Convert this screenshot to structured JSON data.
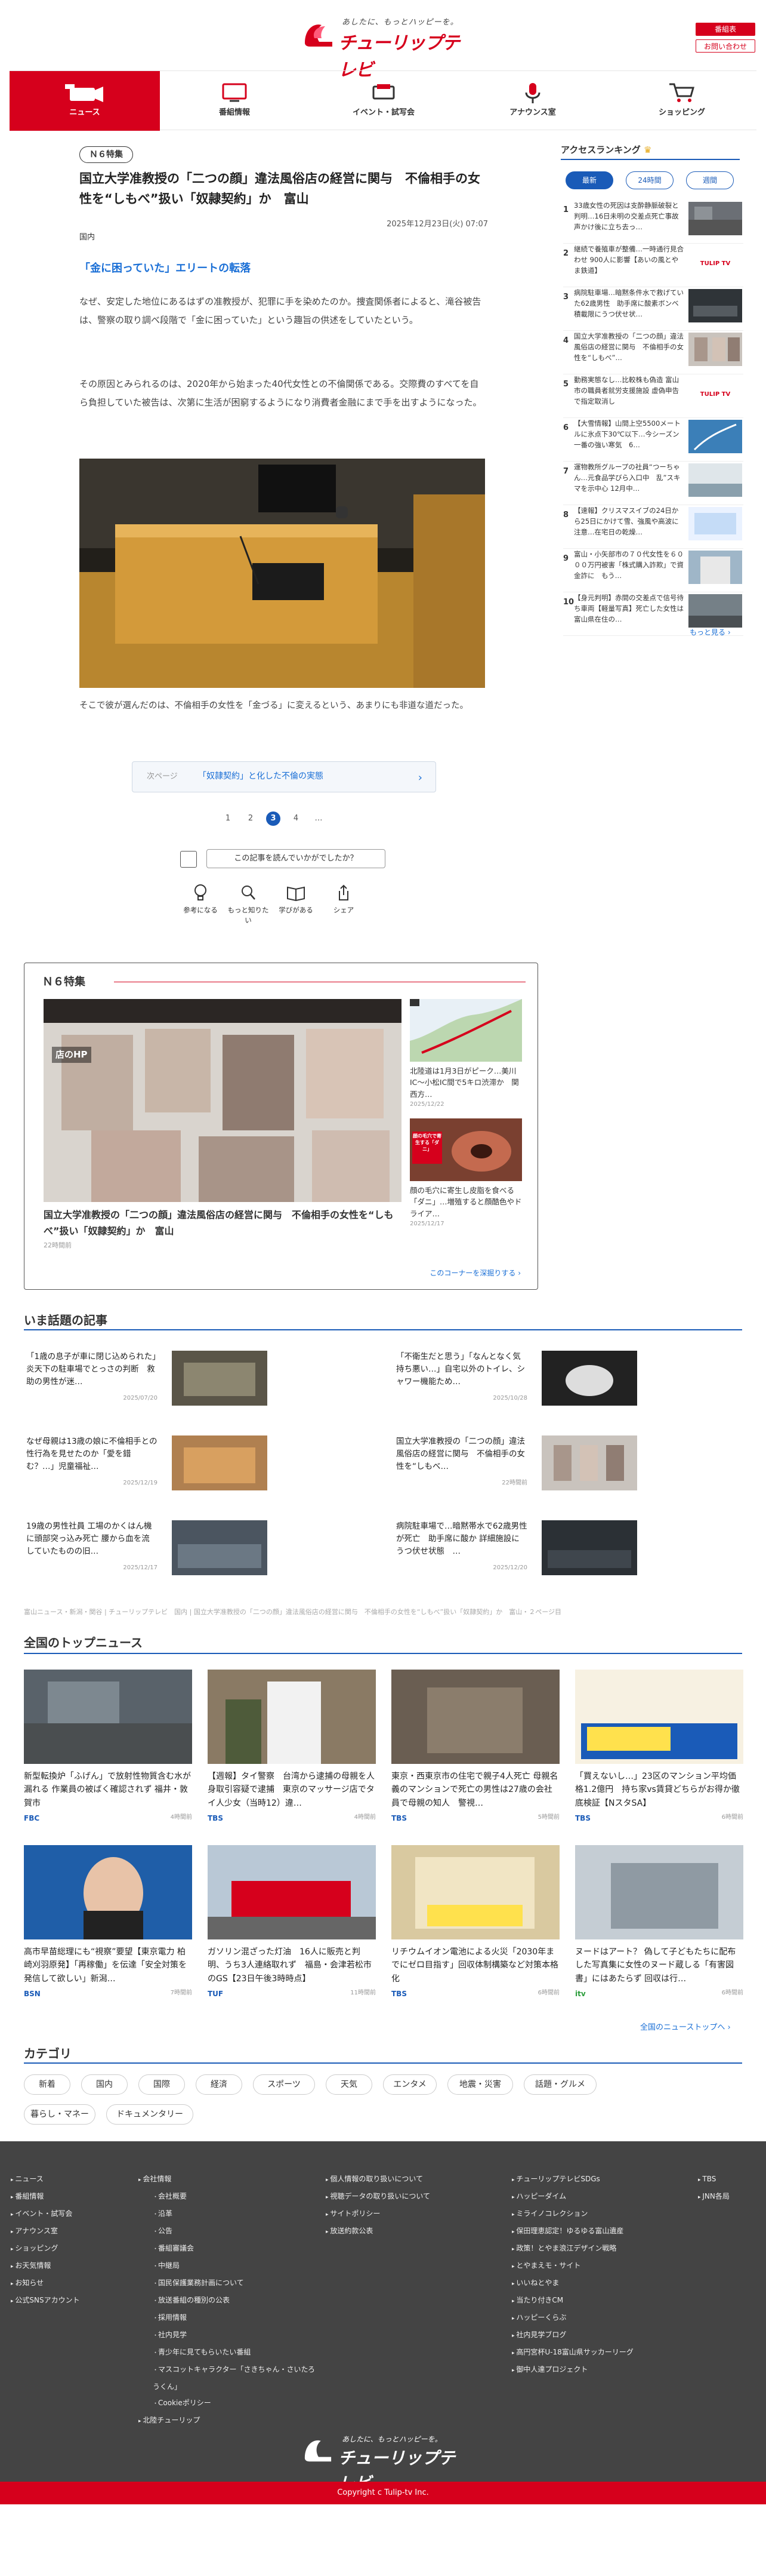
{
  "header": {
    "logo_tagline": "あしたに、もっとハッピーを。",
    "logo_name": "チューリップテレビ",
    "btn_program": "番組表",
    "btn_contact": "お問い合わせ"
  },
  "nav": [
    {
      "label": "ニュース",
      "icon": "news-camera-icon",
      "active": true
    },
    {
      "label": "番組情報",
      "icon": "tv-icon",
      "active": false
    },
    {
      "label": "イベント・試写会",
      "icon": "ticket-icon",
      "active": false
    },
    {
      "label": "アナウンス室",
      "icon": "microphone-icon",
      "active": false
    },
    {
      "label": "ショッピング",
      "icon": "cart-icon",
      "active": false
    }
  ],
  "article": {
    "badge": "Ｎ６特集",
    "title": "国立大学准教授の「二つの顔」違法風俗店の経営に関与　不倫相手の女性を“しもべ”扱い「奴隷契約」か　富山",
    "date": "2025年12月23日(火) 07:07",
    "category": "国内",
    "subheading": "「金に困っていた」エリートの転落",
    "para1": "なぜ、安定した地位にあるはずの准教授が、犯罪に手を染めたのか。捜査関係者によると、滝谷被告は、警察の取り調べ段階で「金に困っていた」という趣旨の供述をしていたという。",
    "para2": "その原因とみられるのは、2020年から始まった40代女性との不倫関係である。交際費のすべてを自ら負担していた被告は、次第に生活が困窮するようになり消費者金融にまで手を出すようになった。",
    "caption": "そこで彼が選んだのは、不倫相手の女性を「金づる」に変えるという、あまりにも非道な道だった。",
    "next_label": "次ページ",
    "next_title": "「奴隷契約」と化した不倫の実態",
    "pages": [
      "1",
      "2",
      "3",
      "4",
      "…"
    ],
    "current_page": "3",
    "ask": "この記事を読んでいかがでしたか？",
    "reactions": [
      {
        "label": "参考になる",
        "icon": "lightbulb-icon"
      },
      {
        "label": "もっと知りたい",
        "icon": "magnifier-icon"
      },
      {
        "label": "学びがある",
        "icon": "book-icon"
      },
      {
        "label": "シェア",
        "icon": "share-icon"
      }
    ]
  },
  "ranking": {
    "heading": "アクセスランキング",
    "tabs": [
      "最新",
      "24時間",
      "週間"
    ],
    "active_tab": "最新",
    "items": [
      {
        "n": "1",
        "title": "33歳女性の死因は支酔静脈破裂と判明…16日未明の交差点死亡事故　声かけ後に立ち去っ…",
        "thumb": "street"
      },
      {
        "n": "2",
        "title": "継続で養殖車が整備…一時通行見合わせ 900人に影響【あいの風とやま鉄道】",
        "thumb": "logo"
      },
      {
        "n": "3",
        "title": "病院駐車場…暗黙条件水で救げていた62歳男性　助手席に酸素ボンベ積載限にうつ伏せ状…",
        "thumb": "dark"
      },
      {
        "n": "4",
        "title": "国立大学准教授の「二つの顔」違法風俗店の経営に関与　不倫相手の女性を“しもべ”…",
        "thumb": "blur"
      },
      {
        "n": "5",
        "title": "勤務実態なし…比較株も偽造 富山市の職員者就労支援施設 虚偽申告で指定取消し",
        "thumb": "logo"
      },
      {
        "n": "6",
        "title": "【大雪情報】山間上空5500メートルに氷点下30℃以下…今シーズン一番の強い寒気　6…",
        "thumb": "map"
      },
      {
        "n": "7",
        "title": "運物教所グループの社員“つーちゃん…元食品学びら入口中　乱”スキマを示中心 12月中…",
        "thumb": "snow"
      },
      {
        "n": "8",
        "title": "【速報】クリスマスイブの24日から25日にかけて雪、強風や高波に注意…在宅日の乾燥…",
        "thumb": "weather"
      },
      {
        "n": "9",
        "title": "富山・小矢部市の７０代女性を６０００万円被害「株式購入詐欺」で資金詐に　もう…",
        "thumb": "building"
      },
      {
        "n": "10",
        "title": "【身元判明】赤間の交差点で信号待ち車両【軽量写真】死亡した女性は富山県在住の…",
        "thumb": "road"
      }
    ],
    "more": "もっと見る"
  },
  "n6": {
    "title": "Ｎ６特集",
    "main_label": "店のHP",
    "main_title": "国立大学准教授の「二つの顔」違法風俗店の経営に関与　不倫相手の女性を“しもべ”扱い「奴隷契約」か　富山",
    "main_date": "22時間前",
    "side": [
      {
        "title": "北陸道は1月3日がピーク…美川IC～小松IC間で5キロ渋滞か　関西方…",
        "date": "2025/12/22"
      },
      {
        "title": "顔の毛穴に寄生し皮脂を食べる「ダニ」…増殖すると顔酷色やドライア…",
        "date": "2025/12/17"
      }
    ],
    "side2_caption": "顔の毛穴で寄生する「ダニ」",
    "more": "このコーナーを深掘りする"
  },
  "hot": {
    "heading": "いま話題の記事",
    "items": [
      {
        "title": "「1歳の息子が車に閉じ込められた」炎天下の駐車場でとっさの判断　救助の男性が迷…",
        "date": "2025/07/20"
      },
      {
        "title": "「不衛生だと思う」「なんとなく気持ち悪い…」自宅以外のトイレ、シャワー機能ため…",
        "date": "2025/10/28"
      },
      {
        "title": "なぜ母親は13歳の娘に不倫相手との性行為を見せたのか「愛を錯む？…」児童福祉…",
        "date": "2025/12/19"
      },
      {
        "title": "国立大学准教授の「二つの顔」違法風俗店の経営に関与　不倫相手の女性を“しもべ…",
        "date": "22時間前"
      },
      {
        "title": "19歳の男性社員 工場のかくはん機に頭部突っ込み死亡 腰から血を流していたものの旧…",
        "date": "2025/12/17"
      },
      {
        "title": "病院駐車場で…暗黙帯水で62歳男性が死亡　助手席に酸か 詳細施設にうつ伏せ状態　…",
        "date": "2025/12/20"
      }
    ]
  },
  "breadcrumb": "富山ニュース・新潟・関谷 | チューリップテレビ　国内 | 国立大学准教授の「二つの顔」違法風俗店の経営に関与　不倫相手の女性を“しもべ”扱い「奴隷契約」か　富山・２ページ目",
  "top_news": {
    "heading": "全国のトップニュース",
    "items": [
      {
        "title": "新型転換炉「ふげん」で放射性物質含む水が漏れる 作業員の被ばく確認されず 福井・敦賀市",
        "src": "FBC",
        "date": "4時間前"
      },
      {
        "title": "【週報】タイ警察　台湾から逮捕の母親を人身取引容疑で逮捕　東京のマッサージ店でタイ人少女（当時12）違…",
        "src": "TBS",
        "date": "4時間前"
      },
      {
        "title": "東京・西東京市の住宅で親子4人死亡 母親名義のマンションで死亡の男性は27歳の会社員で母親の知人　警視…",
        "src": "TBS",
        "date": "5時間前"
      },
      {
        "title": "「買えないし…」23区のマンション平均価格1.2億円　持ち家vs賃貸どちらがお得か徹底検証【NスタSA】",
        "src": "TBS",
        "date": "6時間前"
      },
      {
        "title": "高市早苗総理にも“視察”要望【東京電力 柏崎刈羽原発】「再稼働」を伝達「安全対策を発信して欲しい」新潟…",
        "src": "BSN",
        "date": "7時間前"
      },
      {
        "title": "ガソリン混ざった灯油　16人に販売と判明、うち3人連絡取れず　福島・会津若松市のGS【23日午後3時時点】",
        "src": "TUF",
        "date": "11時間前"
      },
      {
        "title": "リチウムイオン電池による火災「2030年までにゼロ目指す」回収体制構築など対策本格化",
        "src": "TBS",
        "date": "6時間前"
      },
      {
        "title": "ヌードはアート？ 偽して子どもたちに配布した写真集に女性のヌード蔵しる「有害図書」にはあたらず 回収は行…",
        "src": "itv",
        "date": "6時間前"
      }
    ],
    "more": "全国のニューストップへ"
  },
  "categories": {
    "heading": "カテゴリ",
    "items": [
      "新着",
      "国内",
      "国際",
      "経済",
      "スポーツ",
      "天気",
      "エンタメ",
      "地震・災害",
      "話題・グルメ",
      "暮らし・マネー",
      "ドキュメンタリー"
    ]
  },
  "footer": {
    "col1": [
      "ニュース",
      "番組情報",
      "イベント・試写会",
      "アナウンス室",
      "ショッピング",
      "お天気情報",
      "お知らせ",
      "公式SNSアカウント"
    ],
    "col2_head": "会社情報",
    "col2_sub": [
      "会社概要",
      "沿革",
      "公告",
      "番組審議会",
      "中継局",
      "国民保護業務計画について",
      "放送番組の種別の公表",
      "採用情報",
      "社内見学",
      "青少年に見てもらいたい番組",
      "マスコットキャラクター「さきちゃん・さいたろうくん」",
      "Cookieポリシー"
    ],
    "col2_tail": "北陸チューリップ",
    "col3": [
      "個人情報の取り扱いについて",
      "視聴データの取り扱いについて",
      "サイトポリシー",
      "放送約款公表"
    ],
    "col4": [
      "チューリップテレビSDGs",
      "ハッピーダイム",
      "ミライノコレクション",
      "保田理恵認定！ゆるゆる富山遺産",
      "政策！とやま浪江デザイン戦略",
      "とやまえモ・サイト",
      "いいねとやま",
      "当たり付きCM",
      "ハッピーくらぶ",
      "社内見学ブログ",
      "高円宮杯U-18富山県サッカーリーグ",
      "御中人達プロジェクト"
    ],
    "col5": [
      "TBS",
      "JNN各局"
    ],
    "logo_tagline": "あしたに、もっとハッピーを。",
    "logo_name": "チューリップテレビ",
    "copyright": "Copyright c Tulip-tv Inc."
  },
  "colors": {
    "brand_red": "#d6001c",
    "accent_blue": "#1a5bb8",
    "footer_bg": "#444444"
  }
}
